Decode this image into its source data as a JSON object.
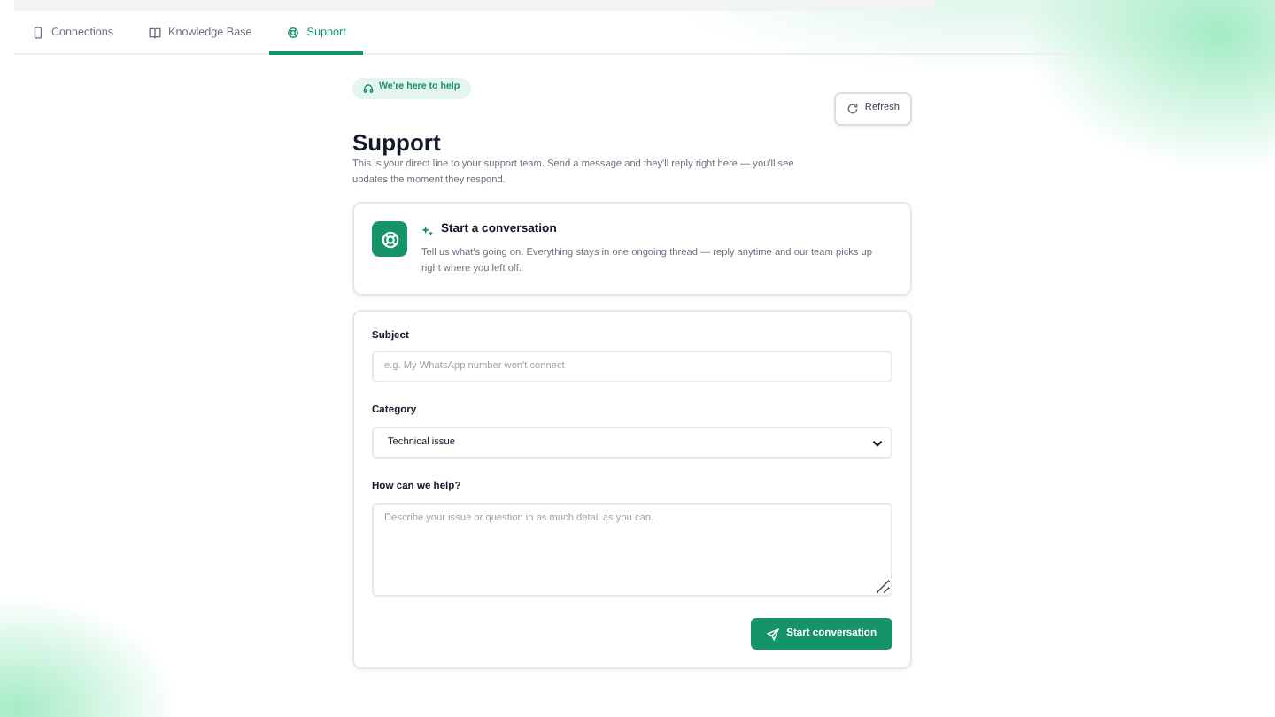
{
  "tabs": [
    {
      "label": "Connections",
      "selected": false
    },
    {
      "label": "Knowledge Base",
      "selected": false
    },
    {
      "label": "Support",
      "selected": true
    }
  ],
  "badge": "We're here to help",
  "refresh_button": "Refresh",
  "title": "Support",
  "subtitle": "This is your direct line to your support team. Send a message and they'll reply right here — you'll see updates the moment they respond.",
  "intro_card": {
    "title": "Start a conversation",
    "text": "Tell us what's going on. Everything stays in one ongoing thread — reply anytime and our team picks up right where you left off."
  },
  "form": {
    "fields": [
      {
        "kind": "text",
        "label": "Subject",
        "placeholder": "e.g. My WhatsApp number won't connect"
      },
      {
        "kind": "select",
        "label": "Category",
        "value": "Technical issue"
      },
      {
        "kind": "textarea",
        "label": "How can we help?",
        "placeholder": "Describe your issue or question in as much detail as you can."
      }
    ],
    "submit": "Start conversation"
  }
}
